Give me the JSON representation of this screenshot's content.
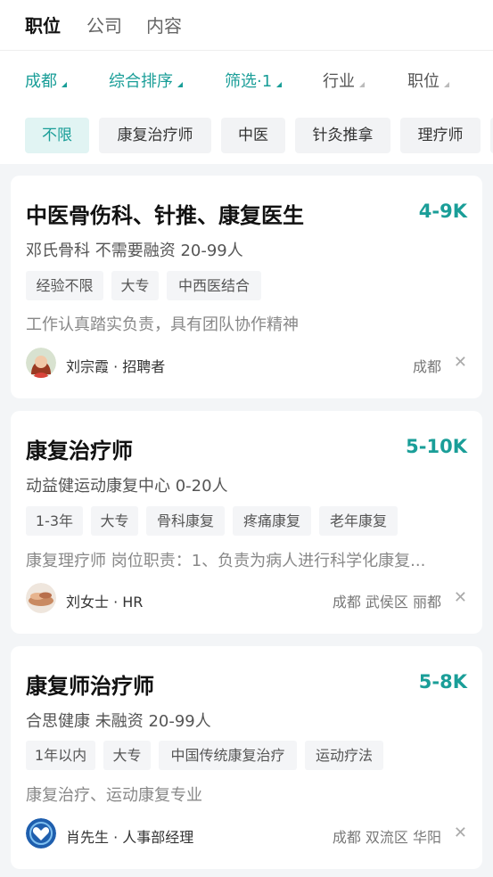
{
  "top_tabs": [
    "职位",
    "公司",
    "内容"
  ],
  "filters": [
    {
      "label": "成都"
    },
    {
      "label": "综合排序"
    },
    {
      "label": "筛选·1"
    },
    {
      "label": "行业"
    },
    {
      "label": "职位"
    }
  ],
  "chips": [
    "不限",
    "康复治疗师",
    "中医",
    "针灸推拿",
    "理疗师"
  ],
  "colors": {
    "accent": "#1a9e98",
    "text": "#111111",
    "muted": "#888888",
    "background": "#f3f5f7"
  },
  "jobs": [
    {
      "title": "中医骨伤科、针推、康复医生",
      "salary": "4-9K",
      "company": "邓氏骨科 不需要融资 20-99人",
      "tags": [
        "经验不限",
        "大专",
        "中西医结合"
      ],
      "desc": "工作认真踏实负责，具有团队协作精神",
      "recruiter": "刘宗霞 · 招聘者",
      "location": "成都",
      "avatar_icon": "woman-avatar-icon"
    },
    {
      "title": "康复治疗师",
      "salary": "5-10K",
      "company": "动益健运动康复中心 0-20人",
      "tags": [
        "1-3年",
        "大专",
        "骨科康复",
        "疼痛康复",
        "老年康复"
      ],
      "desc": "康复理疗师 岗位职责：1、负责为病人进行科学化康复...",
      "recruiter": "刘女士 · HR",
      "location": "成都 武侯区 丽都",
      "avatar_icon": "massage-avatar-icon"
    },
    {
      "title": "康复师治疗师",
      "salary": "5-8K",
      "company": "合思健康 未融资 20-99人",
      "tags": [
        "1年以内",
        "大专",
        "中国传统康复治疗",
        "运动疗法"
      ],
      "desc": "康复治疗、运动康复专业",
      "recruiter": "肖先生 · 人事部经理",
      "location": "成都 双流区 华阳",
      "avatar_icon": "heart-logo-avatar-icon"
    }
  ]
}
